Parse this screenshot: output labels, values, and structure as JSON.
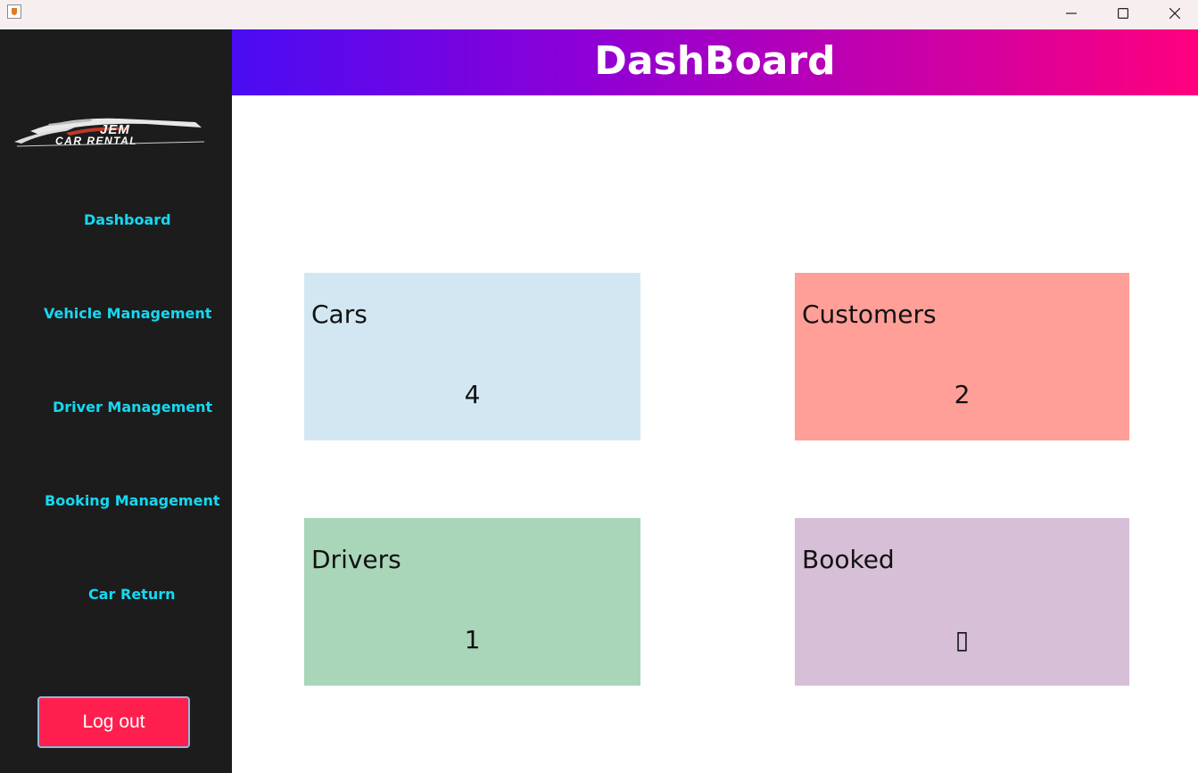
{
  "window": {
    "controls": [
      "minimize-icon",
      "maximize-icon",
      "close-icon"
    ]
  },
  "header": {
    "title": "DashBoard"
  },
  "sidebar": {
    "logo_text": "JEM CAR RENTAL",
    "items": [
      {
        "label": "Dashboard"
      },
      {
        "label": "Vehicle Management"
      },
      {
        "label": "Driver Management"
      },
      {
        "label": "Booking Management"
      },
      {
        "label": "Car Return"
      }
    ],
    "logout_label": "Log out"
  },
  "cards": [
    {
      "label": "Cars",
      "value": "4",
      "color": "#d2e7f2"
    },
    {
      "label": "Customers",
      "value": "2",
      "color": "#ff9f97"
    },
    {
      "label": "Drivers",
      "value": "1",
      "color": "#a9d5b9"
    },
    {
      "label": "Booked",
      "value": "▯",
      "color": "#d6bfd7"
    }
  ],
  "colors": {
    "sidebar_bg": "#1c1c1d",
    "nav_text": "#16d8f0",
    "logout_bg": "#ff1f4e",
    "header_gradient_start": "#4a0cf3",
    "header_gradient_end": "#ff007d"
  }
}
